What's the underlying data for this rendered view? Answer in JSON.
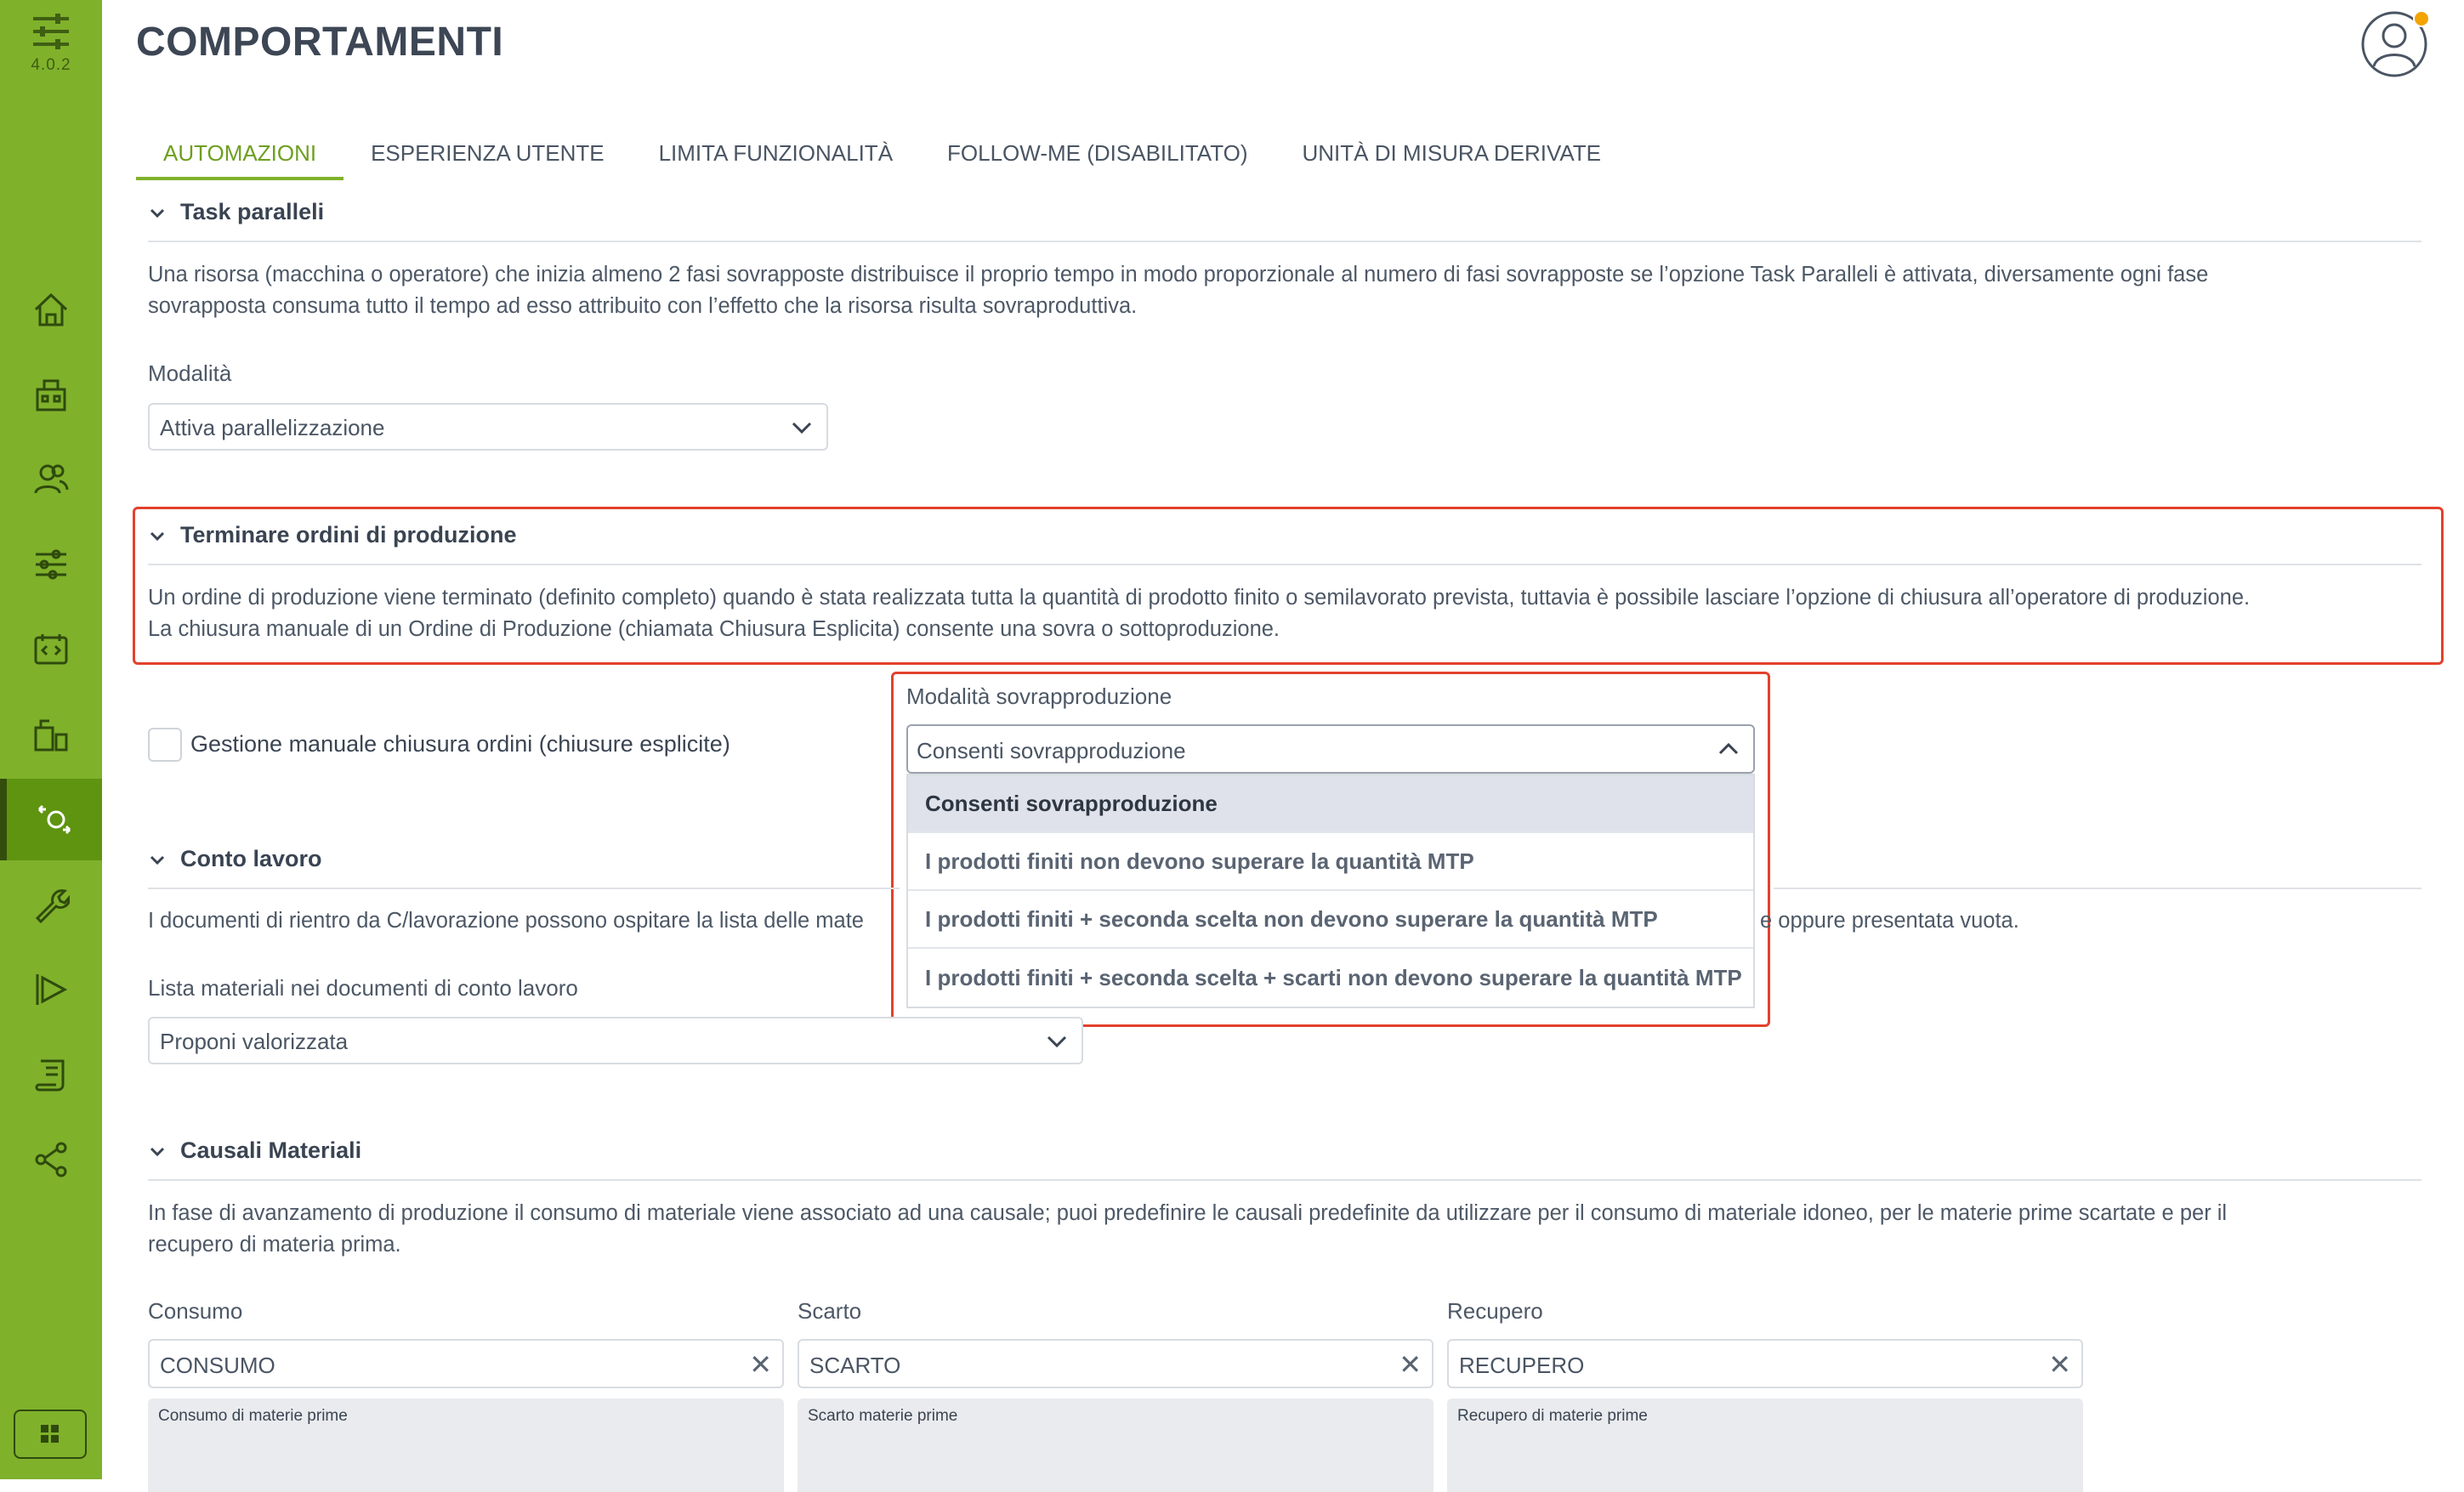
{
  "sidebar": {
    "version": "4.0.2",
    "items": [
      {
        "icon": "home-icon"
      },
      {
        "icon": "building-icon"
      },
      {
        "icon": "users-icon"
      },
      {
        "icon": "sliders-icon"
      },
      {
        "icon": "calendar-code-icon"
      },
      {
        "icon": "machine-icon"
      },
      {
        "icon": "behaviors-icon",
        "active": true
      },
      {
        "icon": "wrench-icon"
      },
      {
        "icon": "play-icon"
      },
      {
        "icon": "scroll-icon"
      },
      {
        "icon": "share-icon"
      }
    ],
    "apps_icon": "grid-icon"
  },
  "header": {
    "title": "COMPORTAMENTI",
    "avatar_icon": "user-avatar-icon"
  },
  "tabs": [
    {
      "label": "AUTOMAZIONI",
      "active": true
    },
    {
      "label": "ESPERIENZA UTENTE"
    },
    {
      "label": "LIMITA FUNZIONALITÀ"
    },
    {
      "label": "FOLLOW-ME (DISABILITATO)"
    },
    {
      "label": "UNITÀ DI MISURA DERIVATE"
    }
  ],
  "task_paralleli": {
    "title": "Task paralleli",
    "desc_line1": "Una risorsa (macchina o operatore) che inizia almeno 2 fasi sovrapposte distribuisce il proprio tempo in modo proporzionale al numero di fasi sovrapposte se l’opzione Task Paralleli è attivata, diversamente ogni fase",
    "desc_line2": "sovrapposta consuma tutto il tempo ad esso attribuito con l’effetto che la risorsa risulta sovraproduttiva.",
    "mode_label": "Modalità",
    "mode_value": "Attiva parallelizzazione"
  },
  "terminare": {
    "title": "Terminare ordini di produzione",
    "desc_line1": "Un ordine di produzione viene terminato (definito completo) quando è stata realizzata tutta la quantità di prodotto finito o semilavorato prevista, tuttavia è possibile lasciare l’opzione di chiusura all’operatore di produzione.",
    "desc_line2": "La chiusura manuale di un Ordine di Produzione (chiamata Chiusura Esplicita) consente una sovra o sottoproduzione.",
    "checkbox_label": "Gestione manuale chiusura ordini (chiusure esplicite)",
    "overprod_label": "Modalità sovrapproduzione",
    "overprod_value": "Consenti sovrapproduzione",
    "options": [
      "Consenti sovrapproduzione",
      "I prodotti finiti non devono superare la quantità MTP",
      "I prodotti finiti + seconda scelta non devono superare la quantità MTP",
      "I prodotti finiti + seconda scelta + scarti non devono superare la quantità MTP"
    ]
  },
  "conto_lavoro": {
    "title": "Conto lavoro",
    "desc_left": "I documenti di rientro da C/lavorazione possono ospitare la lista delle mate",
    "desc_right": "e oppure presentata vuota.",
    "list_label": "Lista materiali nei documenti di conto lavoro",
    "list_value": "Proponi valorizzata"
  },
  "causali": {
    "title": "Causali Materiali",
    "desc_line1": "In fase di avanzamento di produzione il consumo di materiale viene associato ad una causale; puoi predefinire le causali predefinite da utilizzare per il consumo di materiale idoneo, per le materie prime scartate e per il",
    "desc_line2": "recupero di materia prima.",
    "fields": [
      {
        "label": "Consumo",
        "value": "CONSUMO",
        "sub": "Consumo di materie prime"
      },
      {
        "label": "Scarto",
        "value": "SCARTO",
        "sub": "Scarto materie prime"
      },
      {
        "label": "Recupero",
        "value": "RECUPERO",
        "sub": "Recupero di materie prime"
      }
    ]
  },
  "colors": {
    "accent": "#7fb12b",
    "highlight": "#e2412c"
  }
}
